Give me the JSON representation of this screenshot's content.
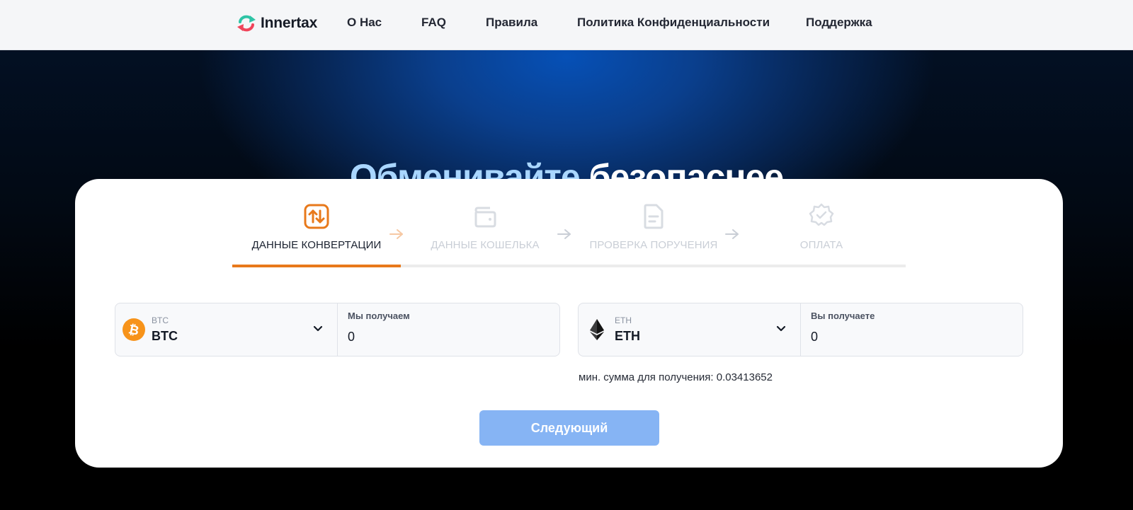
{
  "header": {
    "logo_text": "Innertax",
    "nav": [
      "О Нас",
      "FAQ",
      "Правила",
      "Политика Конфиденциальности",
      "Поддержка"
    ]
  },
  "hero": {
    "title_part1": "Обменивайте",
    "title_part2": "безопаснее"
  },
  "steps": [
    {
      "label": "ДАННЫЕ КОНВЕРТАЦИИ",
      "icon": "swap-arrows-icon",
      "active": true
    },
    {
      "label": "ДАННЫЕ КОШЕЛЬКА",
      "icon": "wallet-icon",
      "active": false
    },
    {
      "label": "ПРОВЕРКА ПОРУЧЕНИЯ",
      "icon": "document-icon",
      "active": false
    },
    {
      "label": "ОПЛАТА",
      "icon": "badge-icon",
      "active": false
    }
  ],
  "send": {
    "coin_small": "BTC",
    "coin_big": "BTC",
    "amount_label": "Мы получаем",
    "amount_value": "0",
    "icon": "bitcoin-icon"
  },
  "receive": {
    "coin_small": "ETH",
    "coin_big": "ETH",
    "amount_label": "Вы получаете",
    "amount_value": "0",
    "icon": "ethereum-icon"
  },
  "min_sum_text": "мин. сумма для получения: 0.03413652",
  "next_button": "Следующий",
  "colors": {
    "accent": "#e8791b",
    "button": "#86b4f4",
    "hero_title_highlight": "#a9d6ff",
    "bitcoin": "#f7931a"
  }
}
